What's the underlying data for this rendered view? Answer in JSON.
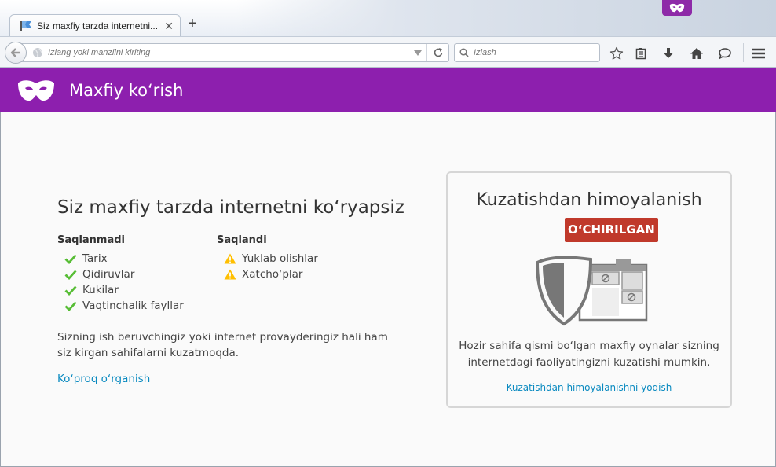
{
  "tab": {
    "title": "Siz maxfiy tarzda internetni ko‘ryapsiz",
    "title_display": "Siz maxfiy tarzda internetni...",
    "close_glyph": "✕",
    "new_tab_glyph": "+"
  },
  "navbar": {
    "url_placeholder": "Izlang yoki manzilni kiriting",
    "search_placeholder": "Izlash",
    "icons": [
      "back-arrow-icon",
      "globe-icon",
      "dropmarker-icon",
      "reload-icon",
      "search-icon",
      "bookmark-star-icon",
      "reading-list-icon",
      "downloads-icon",
      "home-icon",
      "chat-bubble-icon",
      "hamburger-menu-icon"
    ]
  },
  "header": {
    "title": "Maxfiy ko‘rish",
    "icon": "private-mask-icon",
    "color": "#8d1fae"
  },
  "main": {
    "heading": "Siz maxfiy tarzda internetni ko‘ryapsiz",
    "not_saved": {
      "title": "Saqlanmadi",
      "items": [
        "Tarix",
        "Qidiruvlar",
        "Kukilar",
        "Vaqtinchalik fayllar"
      ],
      "icon": "check-icon",
      "icon_color": "#57bd35"
    },
    "saved": {
      "title": "Saqlandi",
      "items": [
        "Yuklab olishlar",
        "Xatcho‘plar"
      ],
      "icon": "warning-icon",
      "icon_color": "#ffbf00"
    },
    "disclaimer": "Sizning ish beruvchingiz yoki internet provayderingiz hali ham siz kirgan sahifalarni kuzatmoqda.",
    "learn_more": "Ko‘proq o‘rganish"
  },
  "tracking": {
    "title": "Kuzatishdan himoyalanish",
    "status": "O‘CHIRILGAN",
    "status_color": "#c0392b",
    "description": "Hozir sahifa qismi bo‘lgan maxfiy oynalar sizning internetdagi faoliyatingizni kuzatishi mumkin.",
    "enable_link": "Kuzatishdan himoyalanishni yoqish"
  }
}
